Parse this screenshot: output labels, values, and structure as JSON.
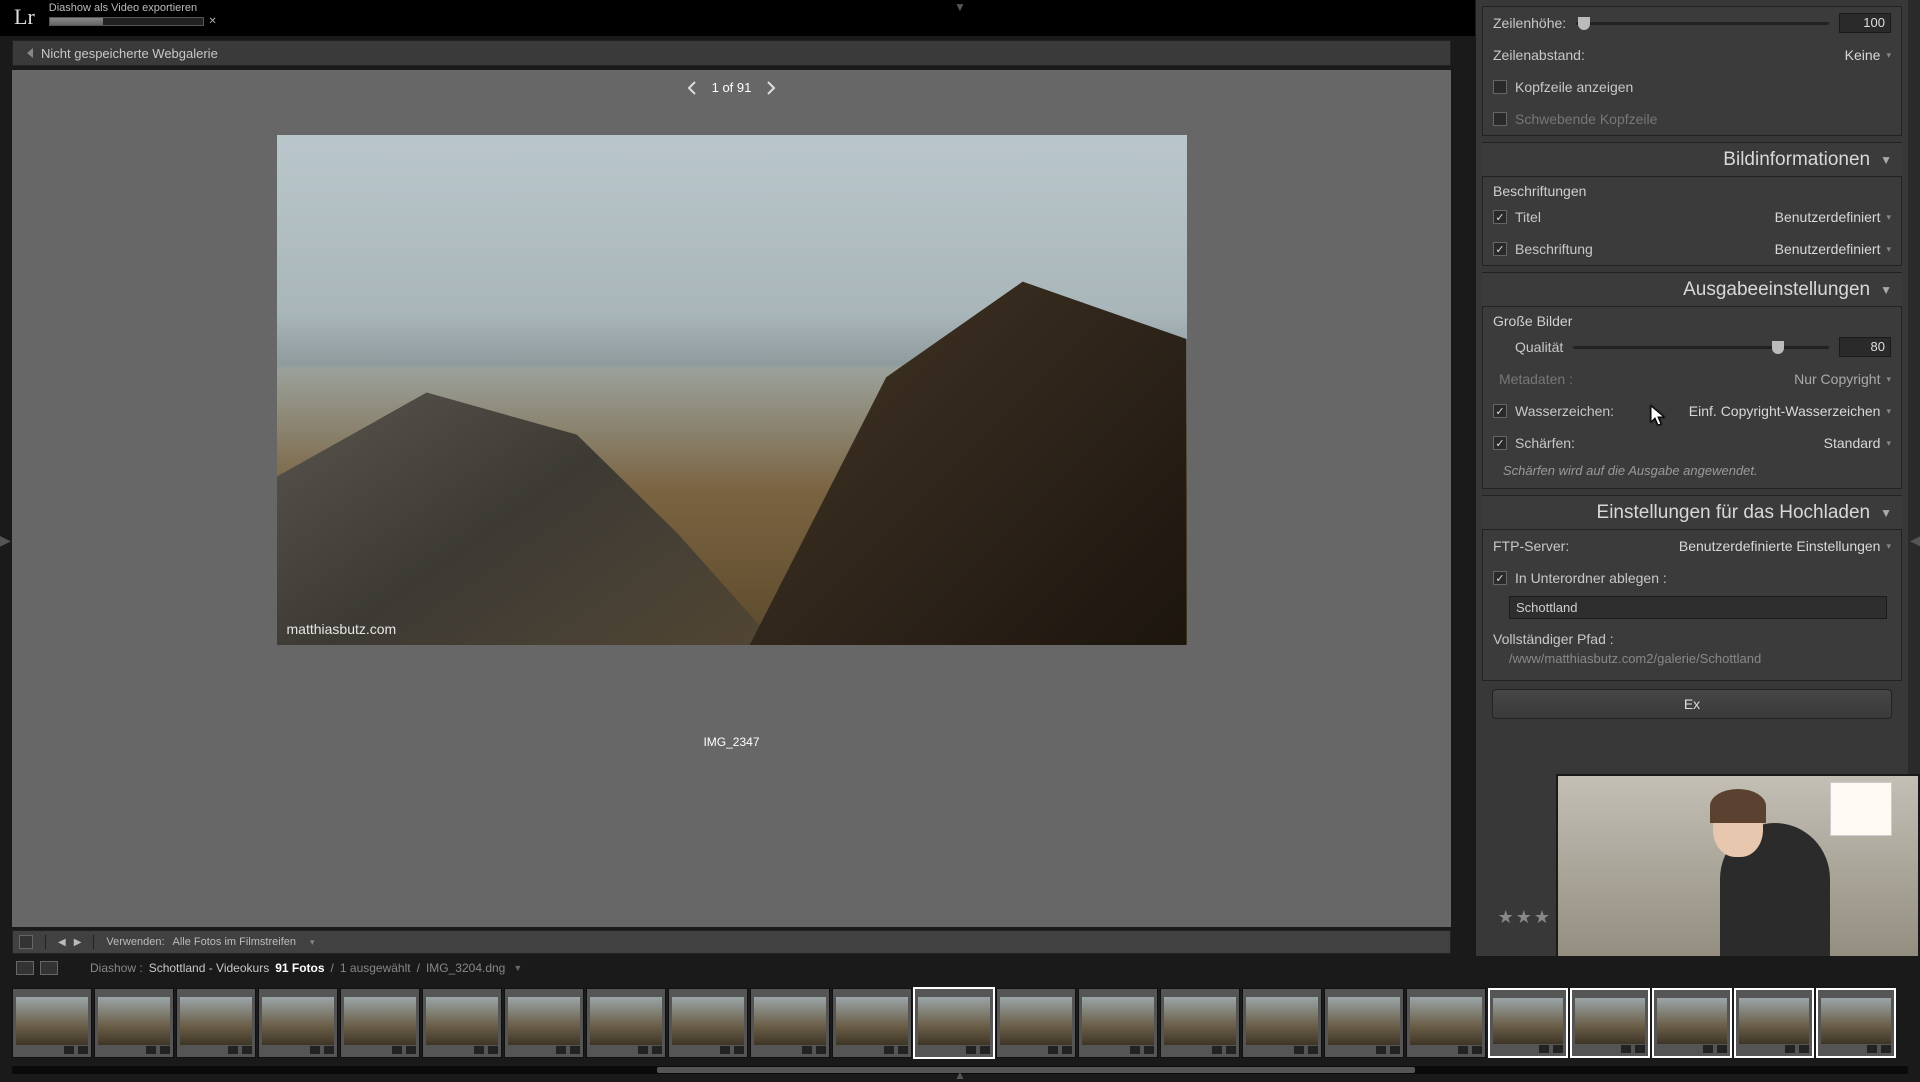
{
  "topbar": {
    "logo": "Lr",
    "export_task": "Diashow als Video exportieren"
  },
  "header": {
    "gallery_title": "Nicht gespeicherte Webgalerie"
  },
  "preview": {
    "page_label": "1 of 91",
    "watermark": "matthiasbutz.com",
    "image_name": "IMG_2347"
  },
  "panel": {
    "row_height_label": "Zeilenhöhe:",
    "row_height_value": "100",
    "row_spacing_label": "Zeilenabstand:",
    "row_spacing_value": "Keine",
    "show_header": "Kopfzeile anzeigen",
    "floating_header": "Schwebende Kopfzeile",
    "section_imageinfo": "Bildinformationen",
    "captions": "Beschriftungen",
    "title_label": "Titel",
    "title_value": "Benutzerdefiniert",
    "caption_label": "Beschriftung",
    "caption_value": "Benutzerdefiniert",
    "section_output": "Ausgabeeinstellungen",
    "large_images": "Große Bilder",
    "quality_label": "Qualität",
    "quality_value": "80",
    "metadata_label": "Metadaten :",
    "metadata_value": "Nur Copyright",
    "watermark_label": "Wasserzeichen:",
    "watermark_value": "Einf. Copyright-Wasserzeichen",
    "sharpen_label": "Schärfen:",
    "sharpen_value": "Standard",
    "sharpen_note": "Schärfen wird auf die Ausgabe angewendet.",
    "section_upload": "Einstellungen für das Hochladen",
    "ftp_label": "FTP-Server:",
    "ftp_value": "Benutzerdefinierte Einstellungen",
    "subfolder_label": "In Unterordner ablegen :",
    "subfolder_value": "Schottland",
    "fullpath_label": "Vollständiger Pfad :",
    "fullpath_value": "/www/matthiasbutz.com2/galerie/Schottland",
    "export_button": "Ex"
  },
  "toolstrip": {
    "use_label": "Verwenden:",
    "use_value": "Alle Fotos im Filmstreifen"
  },
  "info": {
    "breadcrumb_prefix": "Diashow :",
    "breadcrumb1": "Schottland - Videokurs",
    "count": "91 Fotos",
    "selected": "1 ausgewählt",
    "filename": "IMG_3204.dng"
  },
  "filmstrip": {
    "thumb_count": 23,
    "selected_index": 11
  }
}
